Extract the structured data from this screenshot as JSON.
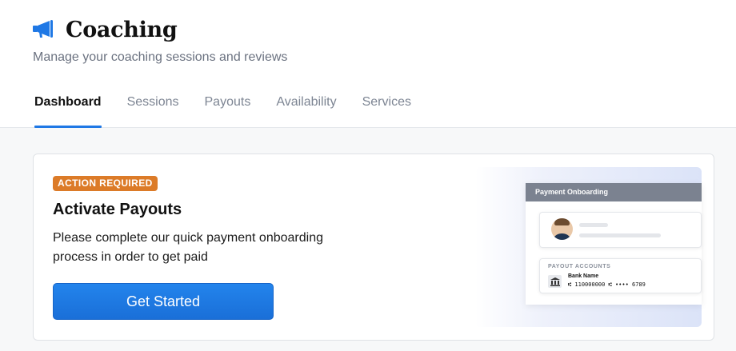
{
  "header": {
    "icon": "megaphone-icon",
    "title": "Coaching",
    "subtitle": "Manage your coaching sessions and reviews"
  },
  "tabs": [
    {
      "label": "Dashboard",
      "active": true
    },
    {
      "label": "Sessions",
      "active": false
    },
    {
      "label": "Payouts",
      "active": false
    },
    {
      "label": "Availability",
      "active": false
    },
    {
      "label": "Services",
      "active": false
    }
  ],
  "card": {
    "badge": "ACTION REQUIRED",
    "title": "Activate Payouts",
    "description": "Please complete our quick payment onboarding process in order to get paid",
    "button_label": "Get Started"
  },
  "illustration": {
    "header": "Payment Onboarding",
    "payout_label": "PAYOUT ACCOUNTS",
    "bank_name": "Bank Name",
    "bank_number": "⑆ 110000000 ⑆ •••• 6789",
    "bank_icon": "bank-icon"
  },
  "colors": {
    "accent": "#1f78e5",
    "badge": "#dc7b28",
    "button": "#1f78e5"
  }
}
